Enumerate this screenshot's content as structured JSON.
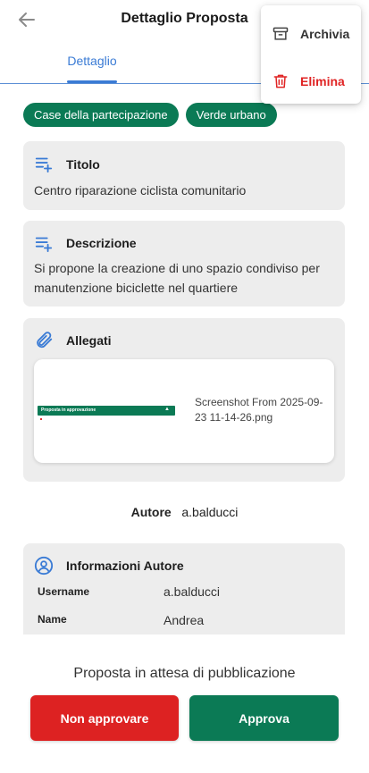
{
  "header": {
    "title": "Dettaglio Proposta",
    "back_icon": "arrow-left-icon"
  },
  "tabs": [
    {
      "label": "Dettaglio",
      "active": true
    }
  ],
  "menu": {
    "items": [
      {
        "label": "Archivia",
        "icon": "archive-icon",
        "color": "#333333"
      },
      {
        "label": "Elimina",
        "icon": "trash-icon",
        "color": "#e02424"
      }
    ]
  },
  "tags": [
    "Case della partecipazione",
    "Verde urbano"
  ],
  "title_card": {
    "heading": "Titolo",
    "icon": "list-add-icon",
    "text": "Centro riparazione ciclista comunitario"
  },
  "description_card": {
    "heading": "Descrizione",
    "icon": "list-add-icon",
    "text": "Si propone la creazione di uno spazio condiviso per manutenzione biciclette nel quartiere"
  },
  "attachments_card": {
    "heading": "Allegati",
    "icon": "paperclip-icon",
    "files": [
      {
        "name": "Screenshot From 2025-09-23 11-14-26.png",
        "thumbnail_text": "Proposta in approvazione"
      }
    ]
  },
  "author": {
    "label": "Autore",
    "value": "a.balducci"
  },
  "author_info": {
    "heading": "Informazioni Autore",
    "icon": "user-circle-icon",
    "rows": [
      {
        "label": "Username",
        "value": "a.balducci"
      },
      {
        "label": "Name",
        "value": "Andrea"
      }
    ]
  },
  "footer": {
    "status": "Proposta in attesa di pubblicazione",
    "reject_label": "Non approvare",
    "approve_label": "Approva"
  },
  "colors": {
    "primary_green": "#0b7a55",
    "danger_red": "#dd2222",
    "tab_blue": "#3a7bd5",
    "card_bg": "#ededed"
  }
}
